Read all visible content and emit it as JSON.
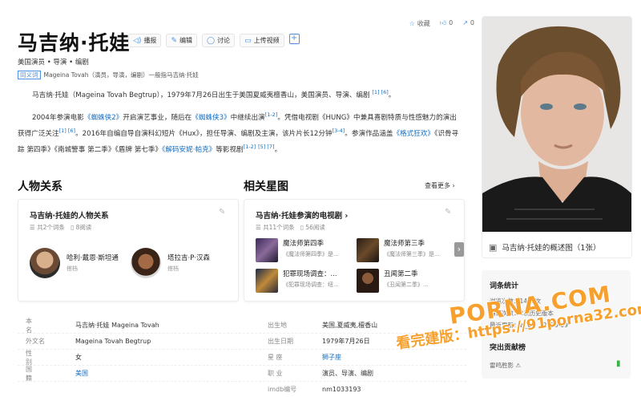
{
  "title": "马吉纳·托娃",
  "toolbar": {
    "play": "播报",
    "edit": "编辑",
    "discuss": "讨论",
    "upload": "上传视频"
  },
  "top_stats": {
    "collect": "收藏",
    "like_count": "0",
    "share_count": "0"
  },
  "subtitle": "美国演员 • 导演 • 编剧",
  "disambiguation": {
    "tag": "同义词",
    "text": "Mageina Tovah（演员，导演，编剧）一般指马吉纳·托娃"
  },
  "intro": {
    "p1": "马吉纳·托娃（Mageina Tovah Begtrup），1979年7月26日出生于美国夏威夷檀香山，美国演员、导演、编剧",
    "p1_refs": "[1]  [6]",
    "p2_a": "2004年参演电影",
    "p2_link1": "《蜘蛛侠2》",
    "p2_b": "开启演艺事业，随后在",
    "p2_link2": "《蜘蛛侠3》",
    "p2_c": "中继续出演",
    "p2_ref1": "[1-2]",
    "p2_d": "。凭借电视剧《HUNG》中兼具喜剧特质与性感魅力的演出获得广泛关注",
    "p2_ref2": "[1]  [6]",
    "p2_e": "。2016年自编自导自演科幻短片《Hux》，担任导演、编剧及主演，该片片长12分钟",
    "p2_ref3": "[3-4]",
    "p2_f": "。参演作品涵盖",
    "p2_link3": "《格式狂欢》",
    "p2_g": "《识骨寻踪 第四季》《南城警事 第二季》《盾牌 第七季》",
    "p2_link4": "《解码安妮·帕克》",
    "p2_h": "等影视剧",
    "p2_ref4": "[1-2]",
    "p2_ref5": "[5]  [7]"
  },
  "relations": {
    "section_title": "人物关系",
    "card_title": "马吉纳·托娃的人物关系",
    "meta_count": "共2个词条",
    "meta_reads": "8阅读",
    "people": [
      {
        "name": "哈利·戴恩·斯坦通",
        "role": "搭档"
      },
      {
        "name": "塔拉吉·P·汉森",
        "role": "搭档"
      }
    ]
  },
  "star_map": {
    "section_title": "相关星图",
    "more": "查看更多",
    "card_title": "马吉纳·托娃参演的电视剧",
    "meta_count": "共11个词条",
    "meta_reads": "56阅读",
    "shows": [
      {
        "name": "魔法师第四季",
        "sub": "《魔法师第四季》是..."
      },
      {
        "name": "魔法师第三季",
        "sub": "《魔法师第三季》是..."
      },
      {
        "name": "犯罪现场调查：...",
        "sub": "《犯罪现场调查：纽..."
      },
      {
        "name": "丑闻第二季",
        "sub": "《丑闻第二季》..."
      }
    ]
  },
  "info": {
    "rows": [
      {
        "k1": "本 名",
        "v1": "马吉纳·托娃 Mageina Tovah",
        "k2": "出生地",
        "v2": "美国,夏威夷,檀香山"
      },
      {
        "k1": "外文名",
        "v1": "Mageina Tovah Begtrup",
        "k2": "出生日期",
        "v2": "1979年7月26日"
      },
      {
        "k1": "性 别",
        "v1": "女",
        "k2": "星 座",
        "v2": "狮子座"
      },
      {
        "k1": "国 籍",
        "v1": "美国",
        "k2": "职 业",
        "v2": "演员、导演、编剧"
      },
      {
        "k1": "",
        "v1": "",
        "k2": "imdb编号",
        "v2": "nm1033193"
      }
    ]
  },
  "photo": {
    "caption": "马吉纳·托娃的概述图（1张）"
  },
  "entry_stats": {
    "title": "词条统计",
    "views": "浏览次数：1483次",
    "edits": "编辑次数：2次历史版本",
    "updated": "最近更新：w_ou （2025-09",
    "feature": "突出贡献榜",
    "bottom": "雷鸣胜影"
  },
  "watermark": {
    "line1": "PORNA.COM",
    "line2": "看完建版：https://91porna32.com"
  },
  "colors": {
    "link": "#136ec2",
    "accent": "#4a90e2",
    "watermark": "#f7a02d"
  }
}
